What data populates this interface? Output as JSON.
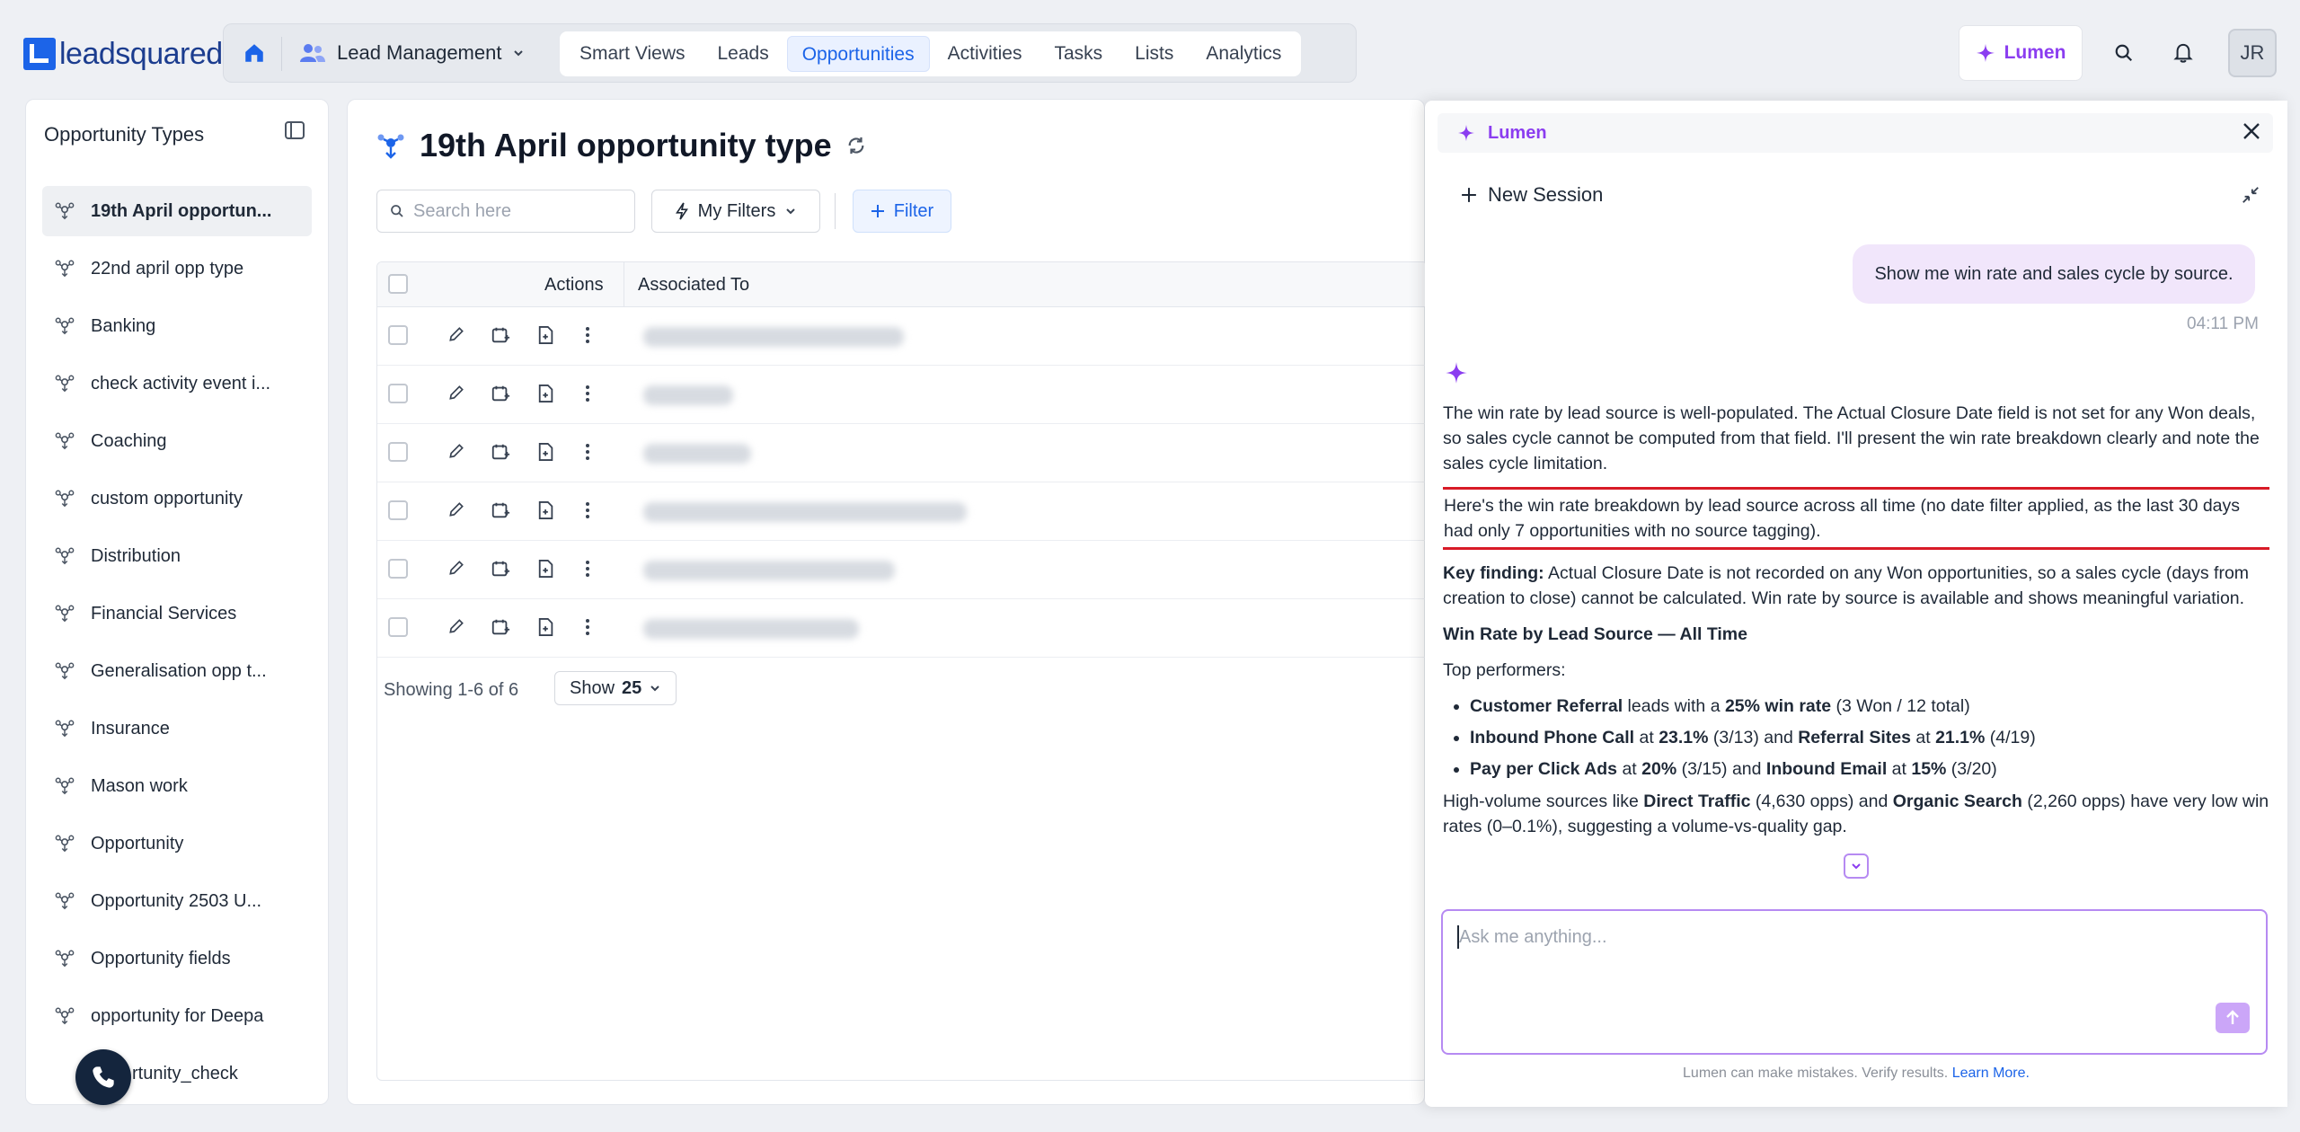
{
  "brand": {
    "logo_text": "leadsquared"
  },
  "nav": {
    "module": "Lead Management",
    "items": [
      "Smart Views",
      "Leads",
      "Opportunities",
      "Activities",
      "Tasks",
      "Lists",
      "Analytics"
    ],
    "active": "Opportunities",
    "lumen_label": "Lumen",
    "avatar_initials": "JR"
  },
  "sidebar": {
    "title": "Opportunity Types",
    "items": [
      "19th April opportun...",
      "22nd april opp type",
      "Banking",
      "check activity event i...",
      "Coaching",
      "custom opportunity",
      "Distribution",
      "Financial Services",
      "Generalisation opp t...",
      "Insurance",
      "Mason work",
      "Opportunity",
      "Opportunity 2503 U...",
      "Opportunity fields",
      "opportunity for Deepa",
      "rtunity_check"
    ]
  },
  "main": {
    "title": "19th April opportunity type",
    "search_placeholder": "Search here",
    "my_filters": "My Filters",
    "filter": "Filter",
    "columns": {
      "actions": "Actions",
      "associated_to": "Associated To"
    },
    "row_count": 6,
    "showing": "Showing 1-6 of 6",
    "show_label": "Show",
    "show_value": "25"
  },
  "lumen": {
    "title": "Lumen",
    "new_session": "New Session",
    "user_message": "Show me win rate and sales cycle by source.",
    "timestamp": "04:11 PM",
    "intro": "The win rate by lead source is well-populated. The Actual Closure Date field is not set for any Won deals, so sales cycle cannot be computed from that field. I'll present the win rate breakdown clearly and note the sales cycle limitation.",
    "highlighted": "Here's the win rate breakdown by lead source across all time (no date filter applied, as the last 30 days had only 7 opportunities with no source tagging).",
    "key_finding_label": "Key finding:",
    "key_finding": "Actual Closure Date is not recorded on any Won opportunities, so a sales cycle (days from creation to close) cannot be calculated. Win rate by source is available and shows meaningful variation.",
    "section_heading": "Win Rate by Lead Source — All Time",
    "top_performers_label": "Top performers:",
    "bullets": [
      {
        "a": "Customer Referral",
        "b": " leads with a ",
        "c": "25% win rate",
        "d": " (3 Won / 12 total)"
      },
      {
        "a": "Inbound Phone Call",
        "b": " at ",
        "c": "23.1%",
        "d": " (3/13) and ",
        "e": "Referral Sites",
        "f": " at ",
        "g": "21.1%",
        "h": " (4/19)"
      },
      {
        "a": "Pay per Click Ads",
        "b": " at ",
        "c": "20%",
        "d": " (3/15) and ",
        "e": "Inbound Email",
        "f": " at ",
        "g": "15%",
        "h": " (3/20)"
      }
    ],
    "high_volume": {
      "p1": "High-volume sources like ",
      "s1": "Direct Traffic",
      "p2": " (4,630 opps) and ",
      "s2": "Organic Search",
      "p3": " (2,260 opps) have very low win rates (0–0.1%), suggesting a volume-vs-quality gap."
    },
    "input_placeholder": "Ask me anything...",
    "disclaimer": "Lumen can make mistakes. Verify results.",
    "learn_more": "Learn More."
  }
}
